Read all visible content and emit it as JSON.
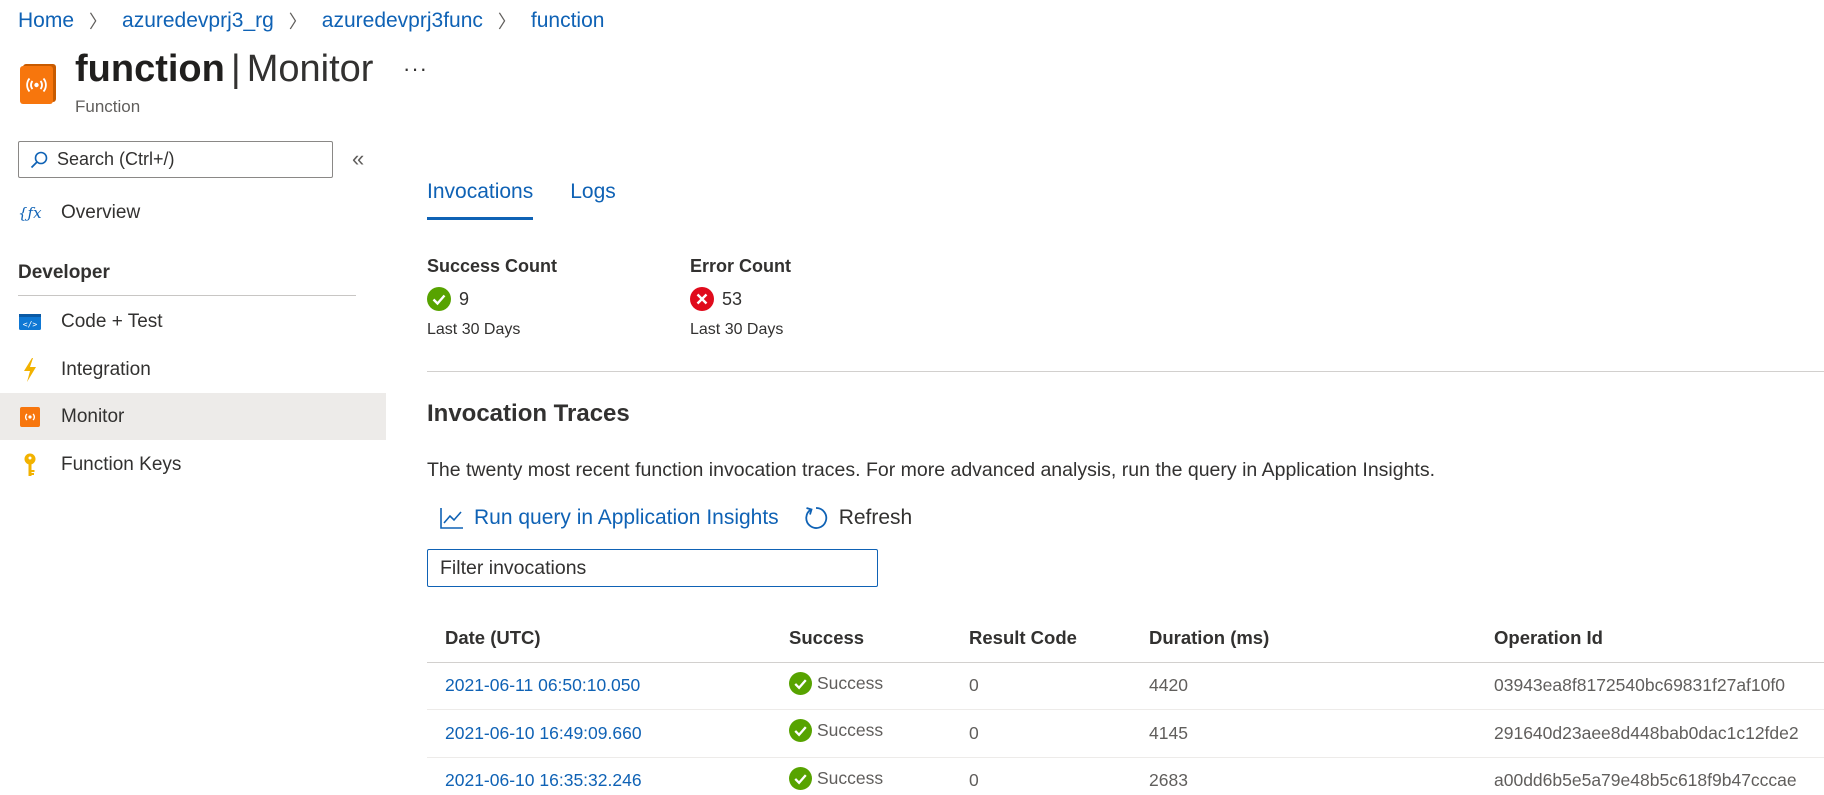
{
  "breadcrumb": [
    "Home",
    "azuredevprj3_rg",
    "azuredevprj3func",
    "function"
  ],
  "header": {
    "title_bold": "function",
    "title_separator": "|",
    "title_rest": "Monitor",
    "more": "···",
    "subtitle": "Function"
  },
  "sidebar": {
    "search_placeholder": "Search (Ctrl+/)",
    "collapse_icon": "«",
    "overview": "Overview",
    "section": "Developer",
    "items": [
      {
        "label": "Code + Test",
        "icon": "code-icon"
      },
      {
        "label": "Integration",
        "icon": "lightning-icon"
      },
      {
        "label": "Monitor",
        "icon": "monitor-icon",
        "active": true
      },
      {
        "label": "Function Keys",
        "icon": "key-icon"
      }
    ]
  },
  "tabs": [
    {
      "label": "Invocations",
      "active": true
    },
    {
      "label": "Logs",
      "active": false
    }
  ],
  "stats": {
    "success": {
      "label": "Success Count",
      "value": "9",
      "period": "Last 30 Days"
    },
    "error": {
      "label": "Error Count",
      "value": "53",
      "period": "Last 30 Days"
    }
  },
  "traces": {
    "title": "Invocation Traces",
    "description": "The twenty most recent function invocation traces. For more advanced analysis, run the query in Application Insights.",
    "run_query": "Run query in Application Insights",
    "refresh": "Refresh",
    "filter_placeholder": "Filter invocations",
    "columns": [
      "Date (UTC)",
      "Success",
      "Result Code",
      "Duration (ms)",
      "Operation Id"
    ],
    "rows": [
      {
        "date": "2021-06-11 06:50:10.050",
        "success": "Success",
        "code": "0",
        "duration": "4420",
        "op": "03943ea8f8172540bc69831f27af10f0"
      },
      {
        "date": "2021-06-10 16:49:09.660",
        "success": "Success",
        "code": "0",
        "duration": "4145",
        "op": "291640d23aee8d448bab0dac1c12fde2"
      },
      {
        "date": "2021-06-10 16:35:32.246",
        "success": "Success",
        "code": "0",
        "duration": "2683",
        "op": "a00dd6b5e5a79e48b5c618f9b47cccae"
      }
    ]
  },
  "colors": {
    "link": "#0f62b5",
    "success": "#57a300",
    "error": "#e00b1c",
    "resource_orange": "#f7760d",
    "active_nav": "#edebe9"
  }
}
